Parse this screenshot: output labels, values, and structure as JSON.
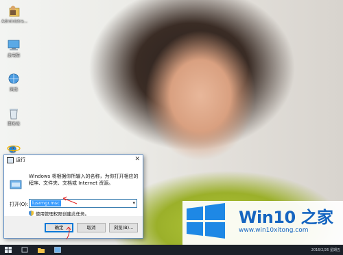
{
  "desktop": {
    "icons": [
      {
        "label": "Administra...",
        "icon": "user-folder-icon"
      },
      {
        "label": "此电脑",
        "icon": "computer-icon"
      },
      {
        "label": "网络",
        "icon": "network-icon"
      },
      {
        "label": "回收站",
        "icon": "recycle-bin-icon"
      },
      {
        "label": "",
        "icon": "internet-explorer-icon"
      }
    ]
  },
  "run_dialog": {
    "title": "运行",
    "description": "Windows 将根据你所输入的名称，为你打开相应的程序、文件夹、文档或 Internet 资源。",
    "open_label": "打开(O):",
    "input_value": "lusrmgr.msc",
    "admin_note": "使用管理权限创建此任务。",
    "buttons": {
      "ok": "确定",
      "cancel": "取消",
      "browse": "浏览(B)..."
    }
  },
  "watermark": {
    "brand": "Win10 之家",
    "site": "www.win10xitong.com"
  },
  "taskbar": {
    "clock": "2016/2/26 星期五"
  },
  "colors": {
    "accent": "#0078d7",
    "annotation": "#e02020",
    "brand": "#1565c0"
  }
}
